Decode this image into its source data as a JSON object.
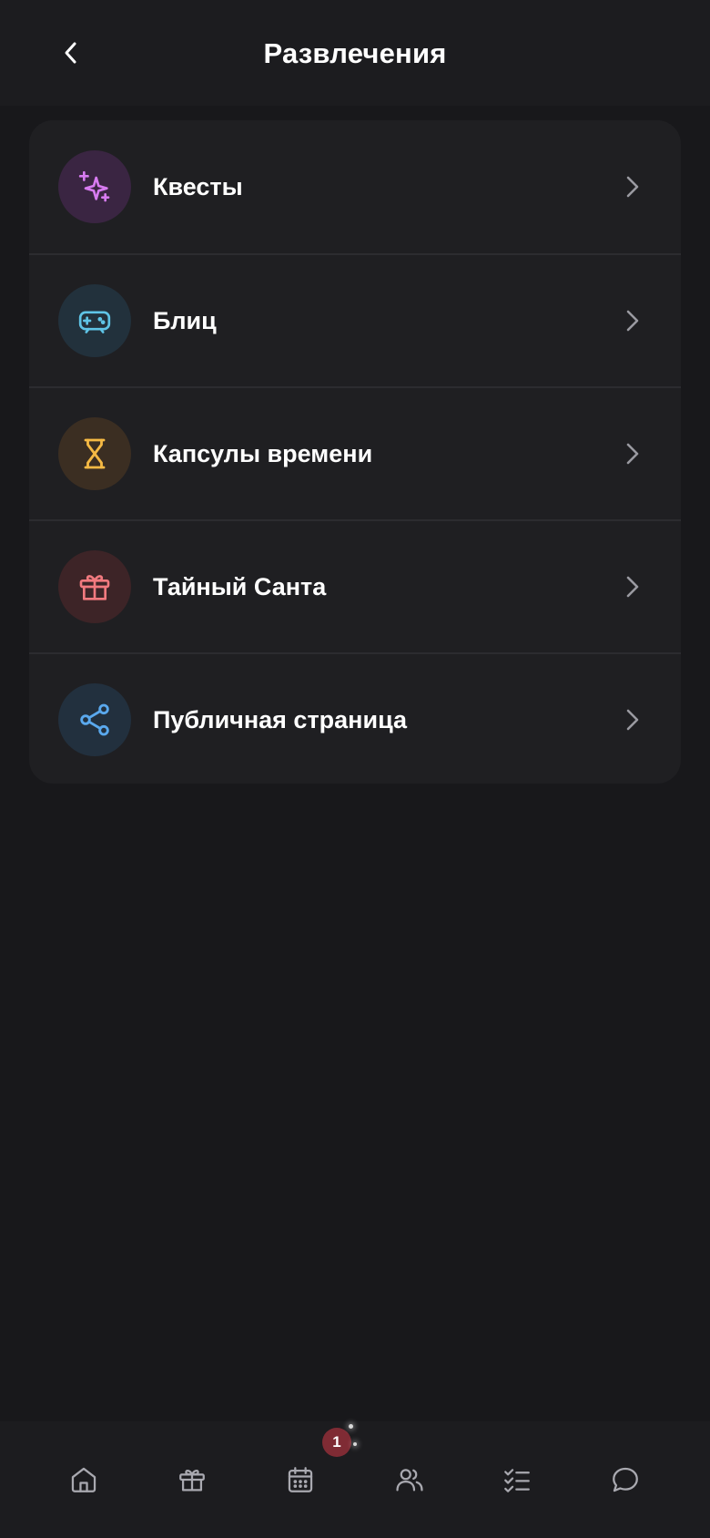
{
  "header": {
    "title": "Развлечения"
  },
  "menu": {
    "items": [
      {
        "label": "Квесты",
        "icon": "sparkles-icon",
        "icon_color": "#d77bf0",
        "icon_bg": "#3a2542"
      },
      {
        "label": "Блиц",
        "icon": "gamepad-icon",
        "icon_color": "#5fc4e6",
        "icon_bg": "#22313c"
      },
      {
        "label": "Капсулы времени",
        "icon": "hourglass-icon",
        "icon_color": "#f5b944",
        "icon_bg": "#3b2e22"
      },
      {
        "label": "Тайный Санта",
        "icon": "gift-icon",
        "icon_color": "#f27a7f",
        "icon_bg": "#3d2427"
      },
      {
        "label": "Публичная страница",
        "icon": "share-icon",
        "icon_color": "#5aa9ee",
        "icon_bg": "#22303e"
      }
    ]
  },
  "tabbar": {
    "tabs": [
      {
        "icon": "home-icon"
      },
      {
        "icon": "gift-icon"
      },
      {
        "icon": "calendar-icon"
      },
      {
        "icon": "users-icon"
      },
      {
        "icon": "checklist-icon"
      },
      {
        "icon": "chat-icon"
      }
    ],
    "badge": {
      "count": "1",
      "color": "#7f2b34"
    }
  },
  "colors": {
    "background": "#18181b",
    "card": "#1f1f22",
    "chevron": "#9a9aa1",
    "tab_icon": "#a9a9b0"
  }
}
